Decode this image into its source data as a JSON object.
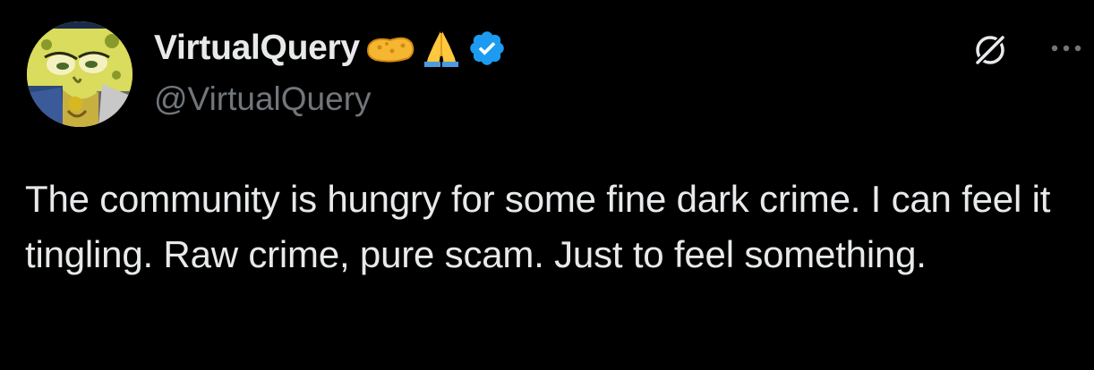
{
  "author": {
    "display_name": "VirtualQuery",
    "handle": "@VirtualQuery",
    "verified": true,
    "avatar": "spongebob-avatar",
    "name_emojis": [
      "sponge-emoji",
      "folded-hands-emoji"
    ]
  },
  "actions": {
    "grok_icon": "grok-icon",
    "more_icon": "more-dots-icon"
  },
  "tweet": {
    "text": "The community is hungry for some fine dark crime. I can feel it tingling. Raw crime, pure scam. Just to feel something."
  },
  "colors": {
    "background": "#000000",
    "primary_text": "#e7e9ea",
    "secondary_text": "#71767b",
    "verified_badge": "#1d9bf0"
  }
}
